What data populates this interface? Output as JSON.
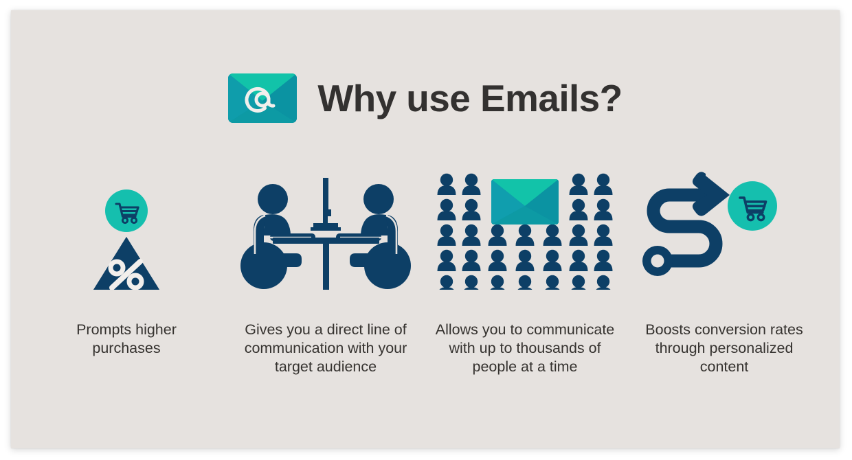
{
  "slide": {
    "background_color": "#e6e2df",
    "title": "Why use Emails?",
    "title_color": "#333130",
    "accent_teal": "#15bfae",
    "accent_navy": "#0d3f66",
    "envelope_teal_dark": "#0e8fa0",
    "envelope_teal_light": "#0fc4a8",
    "title_icon": "email-envelope-at-icon"
  },
  "columns": [
    {
      "icon_name": "discount-triangle-cart-icon",
      "icon_parts": [
        "shopping-cart-circle-icon",
        "percent-triangle-icon"
      ],
      "caption": "Prompts higher purchases"
    },
    {
      "icon_name": "two-people-meeting-table-icon",
      "icon_parts": [
        "person-seated-left-icon",
        "monitor-on-table-icon",
        "person-seated-right-icon"
      ],
      "caption": "Gives you a direct line of communication with your target audience"
    },
    {
      "icon_name": "crowd-with-envelope-icon",
      "icon_parts": [
        "person-grid-icon",
        "email-envelope-icon"
      ],
      "caption": "Allows you to communicate with up to thousands of people at a time"
    },
    {
      "icon_name": "conversion-path-cart-icon",
      "icon_parts": [
        "winding-arrow-path-icon",
        "shopping-cart-circle-icon"
      ],
      "caption": "Boosts conversion rates through personalized content"
    }
  ],
  "crowd": {
    "columns": 7,
    "rows": 5,
    "person_count": 29,
    "envelope_spans_columns": [
      3,
      4,
      5
    ],
    "envelope_spans_rows": [
      1,
      2
    ]
  }
}
